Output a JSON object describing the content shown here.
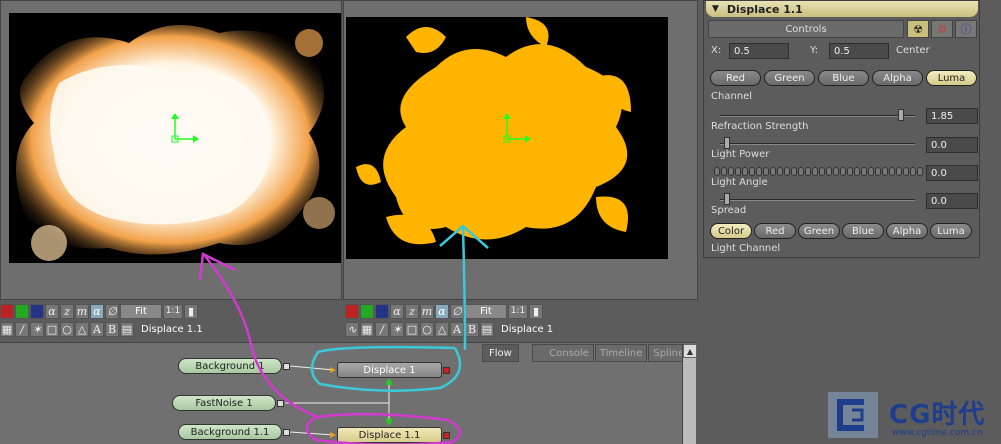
{
  "viewers": {
    "left": {
      "label": "Displace 1.1",
      "fit_label": "Fit",
      "scale_label": "1:1"
    },
    "right": {
      "label": "Displace 1",
      "fit_label": "Fit",
      "scale_label": "1:1"
    }
  },
  "panel": {
    "title": "Displace 1.1",
    "controls_tab": "Controls",
    "center": {
      "x_label": "X:",
      "x_value": "0.5",
      "y_label": "Y:",
      "y_value": "0.5",
      "suffix": "Center"
    },
    "channel_buttons": [
      "Red",
      "Green",
      "Blue",
      "Alpha",
      "Luma"
    ],
    "channel_active": "Luma",
    "channel_label": "Channel",
    "refraction_strength": {
      "value": "1.85",
      "label": "Refraction Strength"
    },
    "light_power": {
      "value": "0.0",
      "label": "Light Power"
    },
    "light_angle": {
      "value": "0.0",
      "label": "Light Angle"
    },
    "spread": {
      "value": "0.0",
      "label": "Spread"
    },
    "light_channel_buttons": [
      "Color",
      "Red",
      "Green",
      "Blue",
      "Alpha",
      "Luma"
    ],
    "light_channel_active": "Color",
    "light_channel_label": "Light Channel"
  },
  "flow": {
    "tabs": [
      "Flow",
      "Console",
      "Timeline",
      "Spline"
    ],
    "active_tab": "Flow",
    "nodes": {
      "background1": "Background 1",
      "displace1": "Displace 1",
      "fastnoise1": "FastNoise 1",
      "background11": "Background 1.1",
      "displace11": "Displace 1.1"
    }
  },
  "watermark": {
    "brand": "CG时代",
    "url": "www.cgtime.com.cn"
  },
  "colors": {
    "accent_yellow": "#d6cc8b",
    "annotation_magenta": "#d23ad0",
    "annotation_cyan": "#3cc8d8",
    "fire_orange": "#ffb200"
  }
}
